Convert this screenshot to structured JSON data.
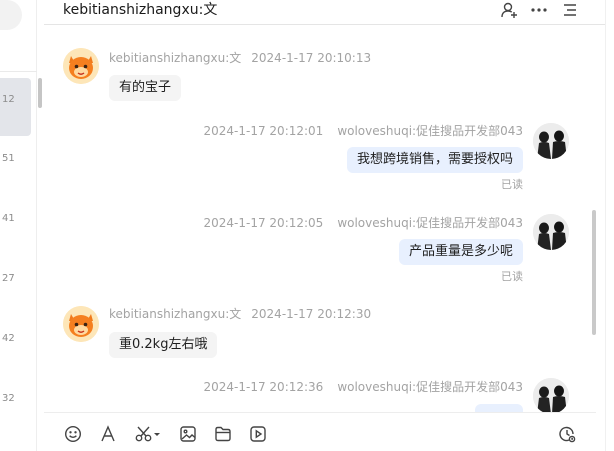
{
  "chat": {
    "title": "kebitianshizhangxu:文"
  },
  "left_panel": {
    "items": [
      "12",
      "51",
      "41",
      "27",
      "42",
      "32"
    ]
  },
  "messages": [
    {
      "direction": "in",
      "sender": "kebitianshizhangxu:文",
      "time": "2024-1-17 20:10:13",
      "text": "有的宝子",
      "status": ""
    },
    {
      "direction": "out",
      "sender": "woloveshuqi:促佳搜品开发部043",
      "time": "2024-1-17 20:12:01",
      "text": "我想跨境销售，需要授权吗",
      "status": "已读"
    },
    {
      "direction": "out",
      "sender": "woloveshuqi:促佳搜品开发部043",
      "time": "2024-1-17 20:12:05",
      "text": "产品重量是多少呢",
      "status": "已读"
    },
    {
      "direction": "in",
      "sender": "kebitianshizhangxu:文",
      "time": "2024-1-17 20:12:30",
      "text": "重0.2kg左右哦",
      "status": ""
    },
    {
      "direction": "out",
      "sender": "woloveshuqi:促佳搜品开发部043",
      "time": "2024-1-17 20:12:36",
      "text": "",
      "status": ""
    }
  ],
  "header_icons": [
    "add-user-icon",
    "more-icon",
    "menu-icon"
  ],
  "toolbar_icons": [
    "emoji-icon",
    "text-format-icon",
    "scissors-icon",
    "image-icon",
    "folder-icon",
    "video-icon",
    "history-icon"
  ],
  "colors": {
    "out_bubble": "#e8f0fe",
    "in_bubble": "#f4f4f4",
    "meta": "#a3a3a3"
  }
}
